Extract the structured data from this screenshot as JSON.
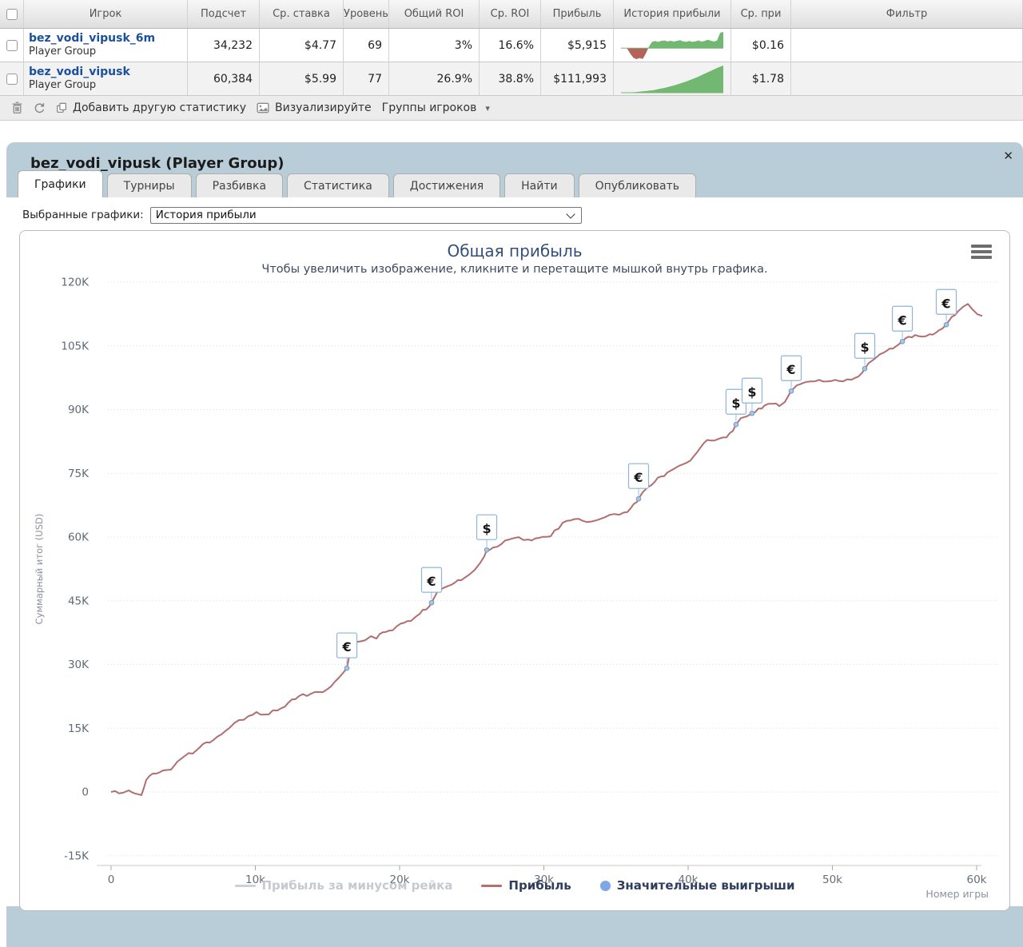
{
  "table": {
    "headers": {
      "player": "Игрок",
      "count": "Подсчет",
      "avg_stake": "Ср. ставка",
      "level": "Уровень",
      "total_roi": "Общий ROI",
      "avg_roi": "Ср. ROI",
      "profit": "Прибыль",
      "profit_history": "История прибыли",
      "avg_prize": "Ср. при",
      "filter": "Фильтр"
    },
    "rows": [
      {
        "name": "bez_vodi_vipusk_6m",
        "type": "Player Group",
        "count": "34,232",
        "avg_stake": "$4.77",
        "level": "69",
        "total_roi": "3%",
        "avg_roi": "16.6%",
        "profit": "$5,915",
        "avg_prize": "$0.16",
        "sparkline": [
          0,
          0,
          -0.2,
          -2,
          -3.5,
          -4,
          -3.6,
          -3.9,
          -2,
          0.5,
          2.3,
          2.6,
          2.3,
          2.6,
          2.8,
          2.5,
          2.7,
          2.4,
          2.6,
          2.9,
          2.5,
          2.3,
          2.6,
          2.3,
          2.5,
          2.8,
          2.4,
          2.6,
          3.1,
          2.7,
          2.4,
          2.8,
          5.6,
          5.9
        ]
      },
      {
        "name": "bez_vodi_vipusk",
        "type": "Player Group",
        "count": "60,384",
        "avg_stake": "$5.99",
        "level": "77",
        "total_roi": "26.9%",
        "avg_roi": "38.8%",
        "profit": "$111,993",
        "avg_prize": "$1.78",
        "sparkline": [
          0,
          0.3,
          0.8,
          1.5,
          2.5,
          4,
          5.5,
          7,
          9,
          11,
          14,
          17,
          20,
          24,
          28,
          32,
          37,
          42,
          47,
          53,
          59,
          65,
          72,
          79,
          86,
          93,
          100,
          106,
          112
        ]
      }
    ]
  },
  "toolbar": {
    "add_stat": "Добавить другую статистику",
    "visualize": "Визуализируйте",
    "groups": "Группы игроков"
  },
  "panel": {
    "title": "bez_vodi_vipusk (Player Group)",
    "close": "✕",
    "tabs": [
      "Графики",
      "Турниры",
      "Разбивка",
      "Статистика",
      "Достижения",
      "Найти",
      "Опубликовать"
    ],
    "selected_graphs_label": "Выбранные графики:",
    "selected_graph": "История прибыли"
  },
  "colors": {
    "link_blue": "#1c4f9c",
    "panel_bg": "#b9cdd9",
    "spark_green": "#72b872",
    "spark_red": "#b4625a",
    "profit_line": "#b26e6e",
    "significant_win_blue": "#7da7e8"
  },
  "chart_data": {
    "type": "line",
    "title": "Общая прибыль",
    "subtitle": "Чтобы увеличить изображение, кликните и перетащите мышкой внутрь графика.",
    "ylabel": "Суммарный итог (USD)",
    "xlabel": "Номер игры",
    "x_range": [
      0,
      60000
    ],
    "y_range": [
      -15000,
      120000
    ],
    "grid": true,
    "legend_position": "bottom",
    "yticks": [
      {
        "v": 120000,
        "label": "120K"
      },
      {
        "v": 105000,
        "label": "105K"
      },
      {
        "v": 90000,
        "label": "90K"
      },
      {
        "v": 75000,
        "label": "75K"
      },
      {
        "v": 60000,
        "label": "60K"
      },
      {
        "v": 45000,
        "label": "45K"
      },
      {
        "v": 30000,
        "label": "30K"
      },
      {
        "v": 15000,
        "label": "15K"
      },
      {
        "v": 0,
        "label": "0"
      },
      {
        "v": -15000,
        "label": "-15K"
      }
    ],
    "xticks": [
      {
        "v": 0,
        "label": "0"
      },
      {
        "v": 10000,
        "label": "10k"
      },
      {
        "v": 20000,
        "label": "20k"
      },
      {
        "v": 30000,
        "label": "30k"
      },
      {
        "v": 40000,
        "label": "40k"
      },
      {
        "v": 50000,
        "label": "50k"
      },
      {
        "v": 60000,
        "label": "60k"
      }
    ],
    "legend": [
      {
        "label": "Прибыль за минусом рейка",
        "color": "#cdd0d4",
        "type": "line",
        "disabled": true
      },
      {
        "label": "Прибыль",
        "color": "#b96f6f",
        "type": "line",
        "disabled": false
      },
      {
        "label": "Значительные выигрыши",
        "color": "#7da7e8",
        "type": "dot",
        "disabled": false
      }
    ],
    "series": [
      {
        "name": "Прибыль",
        "color": "#b26e6e",
        "points": [
          [
            0,
            0
          ],
          [
            830,
            -190
          ],
          [
            1220,
            375
          ],
          [
            1660,
            -375
          ],
          [
            2100,
            -750
          ],
          [
            2270,
            940
          ],
          [
            2440,
            2820
          ],
          [
            2880,
            4320
          ],
          [
            3600,
            5075
          ],
          [
            4155,
            5265
          ],
          [
            4600,
            7145
          ],
          [
            5100,
            8460
          ],
          [
            5650,
            9025
          ],
          [
            6370,
            11280
          ],
          [
            7090,
            12220
          ],
          [
            7645,
            13535
          ],
          [
            8200,
            15040
          ],
          [
            8865,
            16920
          ],
          [
            9530,
            17860
          ],
          [
            10080,
            18800
          ],
          [
            10640,
            18235
          ],
          [
            11525,
            19175
          ],
          [
            12300,
            21055
          ],
          [
            13020,
            22560
          ],
          [
            13850,
            23125
          ],
          [
            14680,
            23500
          ],
          [
            15235,
            24815
          ],
          [
            15790,
            26885
          ],
          [
            16120,
            28200
          ],
          [
            16345,
            29140
          ],
          [
            16620,
            33840
          ],
          [
            17065,
            35345
          ],
          [
            17620,
            35720
          ],
          [
            18010,
            36660
          ],
          [
            18395,
            36100
          ],
          [
            18840,
            37600
          ],
          [
            19280,
            37975
          ],
          [
            19780,
            38915
          ],
          [
            20330,
            39855
          ],
          [
            20775,
            40230
          ],
          [
            21165,
            41360
          ],
          [
            21605,
            42865
          ],
          [
            22050,
            43615
          ],
          [
            22215,
            44555
          ],
          [
            22600,
            47000
          ],
          [
            22990,
            47940
          ],
          [
            23380,
            48500
          ],
          [
            23820,
            49255
          ],
          [
            24265,
            49820
          ],
          [
            24820,
            51135
          ],
          [
            25205,
            52265
          ],
          [
            25595,
            53955
          ],
          [
            25870,
            55460
          ],
          [
            26040,
            56960
          ],
          [
            26480,
            57530
          ],
          [
            27035,
            58280
          ],
          [
            27590,
            59410
          ],
          [
            28255,
            59975
          ],
          [
            28920,
            59410
          ],
          [
            29640,
            59785
          ],
          [
            30470,
            60160
          ],
          [
            31300,
            63355
          ],
          [
            31855,
            63920
          ],
          [
            32410,
            64295
          ],
          [
            32965,
            63545
          ],
          [
            33630,
            63920
          ],
          [
            34240,
            64670
          ],
          [
            34900,
            65425
          ],
          [
            35565,
            65800
          ],
          [
            36010,
            66740
          ],
          [
            36450,
            68245
          ],
          [
            36565,
            68995
          ],
          [
            36840,
            70500
          ],
          [
            37230,
            71815
          ],
          [
            37675,
            72945
          ],
          [
            38115,
            74260
          ],
          [
            38560,
            75200
          ],
          [
            39060,
            76140
          ],
          [
            39610,
            77080
          ],
          [
            40165,
            78020
          ],
          [
            40610,
            79900
          ],
          [
            41105,
            82155
          ],
          [
            41550,
            82720
          ],
          [
            42105,
            83100
          ],
          [
            42660,
            83470
          ],
          [
            43100,
            84975
          ],
          [
            43320,
            86480
          ],
          [
            43655,
            87985
          ],
          [
            44040,
            88360
          ],
          [
            44430,
            89110
          ],
          [
            44875,
            90240
          ],
          [
            45315,
            90990
          ],
          [
            45870,
            91370
          ],
          [
            46315,
            90805
          ],
          [
            46700,
            91745
          ],
          [
            46980,
            93435
          ],
          [
            47145,
            94375
          ],
          [
            47530,
            95690
          ],
          [
            47975,
            96255
          ],
          [
            48530,
            96630
          ],
          [
            49085,
            97005
          ],
          [
            49640,
            96630
          ],
          [
            50195,
            97005
          ],
          [
            50750,
            96630
          ],
          [
            51300,
            97005
          ],
          [
            51800,
            97760
          ],
          [
            52075,
            98700
          ],
          [
            52245,
            99640
          ],
          [
            52520,
            100955
          ],
          [
            52910,
            101895
          ],
          [
            53295,
            103025
          ],
          [
            53740,
            103775
          ],
          [
            54185,
            104340
          ],
          [
            54570,
            105280
          ],
          [
            54850,
            106030
          ],
          [
            55290,
            107160
          ],
          [
            55735,
            107540
          ],
          [
            56290,
            107160
          ],
          [
            56730,
            107725
          ],
          [
            57175,
            108100
          ],
          [
            57615,
            109040
          ],
          [
            57895,
            109980
          ],
          [
            58280,
            111860
          ],
          [
            58725,
            113175
          ],
          [
            59110,
            114305
          ],
          [
            59390,
            114870
          ],
          [
            59720,
            113550
          ],
          [
            60055,
            112425
          ],
          [
            60390,
            112050
          ]
        ]
      }
    ],
    "markers": [
      {
        "symbol": "€",
        "x": 16345,
        "y": 29140
      },
      {
        "symbol": "€",
        "x": 22215,
        "y": 44555
      },
      {
        "symbol": "$",
        "x": 26040,
        "y": 56960
      },
      {
        "symbol": "€",
        "x": 36565,
        "y": 68995
      },
      {
        "symbol": "$",
        "x": 43320,
        "y": 86480
      },
      {
        "symbol": "$",
        "x": 44430,
        "y": 89110
      },
      {
        "symbol": "€",
        "x": 47145,
        "y": 94375
      },
      {
        "symbol": "$",
        "x": 52245,
        "y": 99640
      },
      {
        "symbol": "€",
        "x": 54850,
        "y": 106030
      },
      {
        "symbol": "€",
        "x": 57895,
        "y": 109980
      }
    ]
  }
}
